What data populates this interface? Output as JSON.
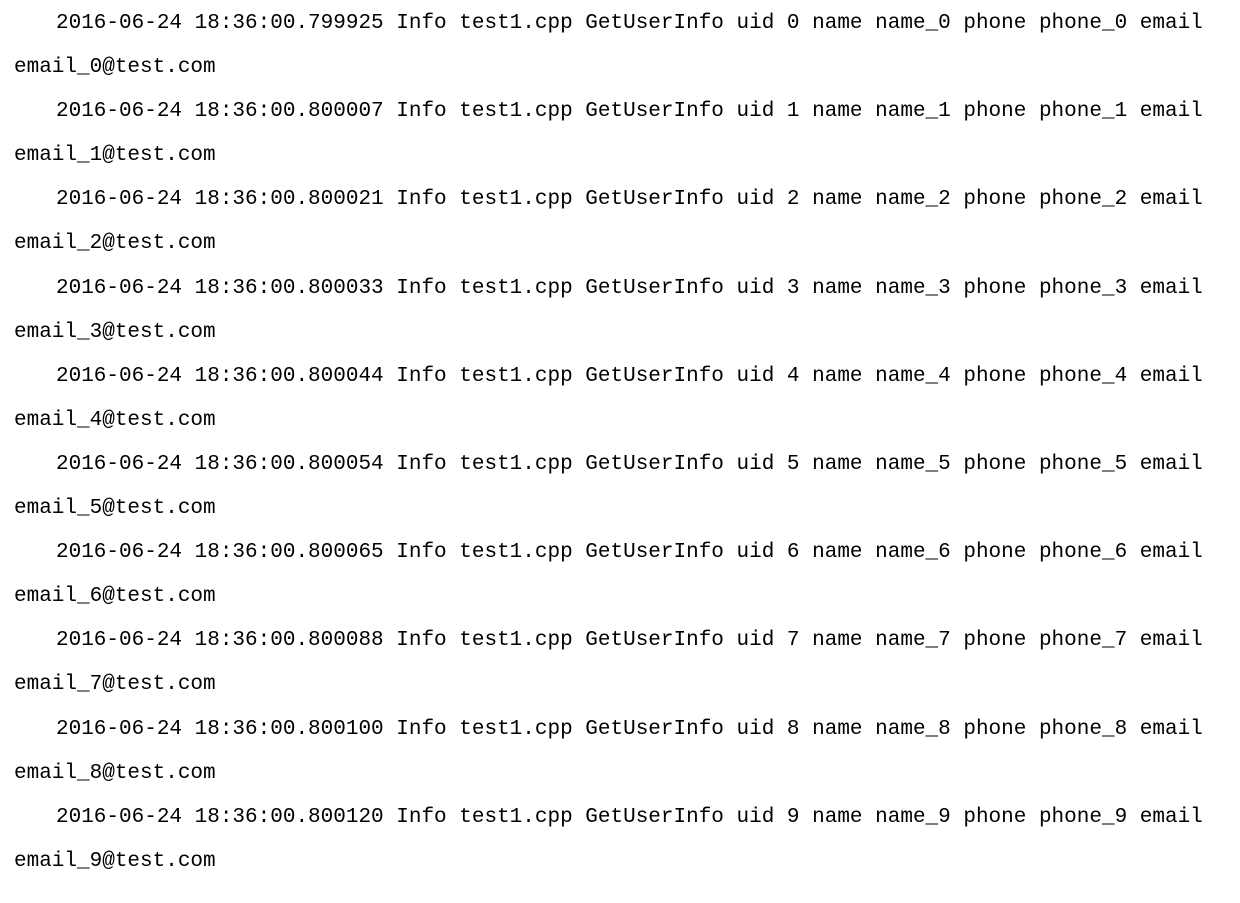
{
  "logs": [
    {
      "timestamp": "2016-06-24 18:36:00.799925",
      "level": "Info",
      "source": "test1.cpp",
      "function": "GetUserInfo",
      "uid": 0,
      "name": "name_0",
      "phone": "phone_0",
      "email": "email_0@test.com"
    },
    {
      "timestamp": "2016-06-24 18:36:00.800007",
      "level": "Info",
      "source": "test1.cpp",
      "function": "GetUserInfo",
      "uid": 1,
      "name": "name_1",
      "phone": "phone_1",
      "email": "email_1@test.com"
    },
    {
      "timestamp": "2016-06-24 18:36:00.800021",
      "level": "Info",
      "source": "test1.cpp",
      "function": "GetUserInfo",
      "uid": 2,
      "name": "name_2",
      "phone": "phone_2",
      "email": "email_2@test.com"
    },
    {
      "timestamp": "2016-06-24 18:36:00.800033",
      "level": "Info",
      "source": "test1.cpp",
      "function": "GetUserInfo",
      "uid": 3,
      "name": "name_3",
      "phone": "phone_3",
      "email": "email_3@test.com"
    },
    {
      "timestamp": "2016-06-24 18:36:00.800044",
      "level": "Info",
      "source": "test1.cpp",
      "function": "GetUserInfo",
      "uid": 4,
      "name": "name_4",
      "phone": "phone_4",
      "email": "email_4@test.com"
    },
    {
      "timestamp": "2016-06-24 18:36:00.800054",
      "level": "Info",
      "source": "test1.cpp",
      "function": "GetUserInfo",
      "uid": 5,
      "name": "name_5",
      "phone": "phone_5",
      "email": "email_5@test.com"
    },
    {
      "timestamp": "2016-06-24 18:36:00.800065",
      "level": "Info",
      "source": "test1.cpp",
      "function": "GetUserInfo",
      "uid": 6,
      "name": "name_6",
      "phone": "phone_6",
      "email": "email_6@test.com"
    },
    {
      "timestamp": "2016-06-24 18:36:00.800088",
      "level": "Info",
      "source": "test1.cpp",
      "function": "GetUserInfo",
      "uid": 7,
      "name": "name_7",
      "phone": "phone_7",
      "email": "email_7@test.com"
    },
    {
      "timestamp": "2016-06-24 18:36:00.800100",
      "level": "Info",
      "source": "test1.cpp",
      "function": "GetUserInfo",
      "uid": 8,
      "name": "name_8",
      "phone": "phone_8",
      "email": "email_8@test.com"
    },
    {
      "timestamp": "2016-06-24 18:36:00.800120",
      "level": "Info",
      "source": "test1.cpp",
      "function": "GetUserInfo",
      "uid": 9,
      "name": "name_9",
      "phone": "phone_9",
      "email": "email_9@test.com"
    }
  ]
}
